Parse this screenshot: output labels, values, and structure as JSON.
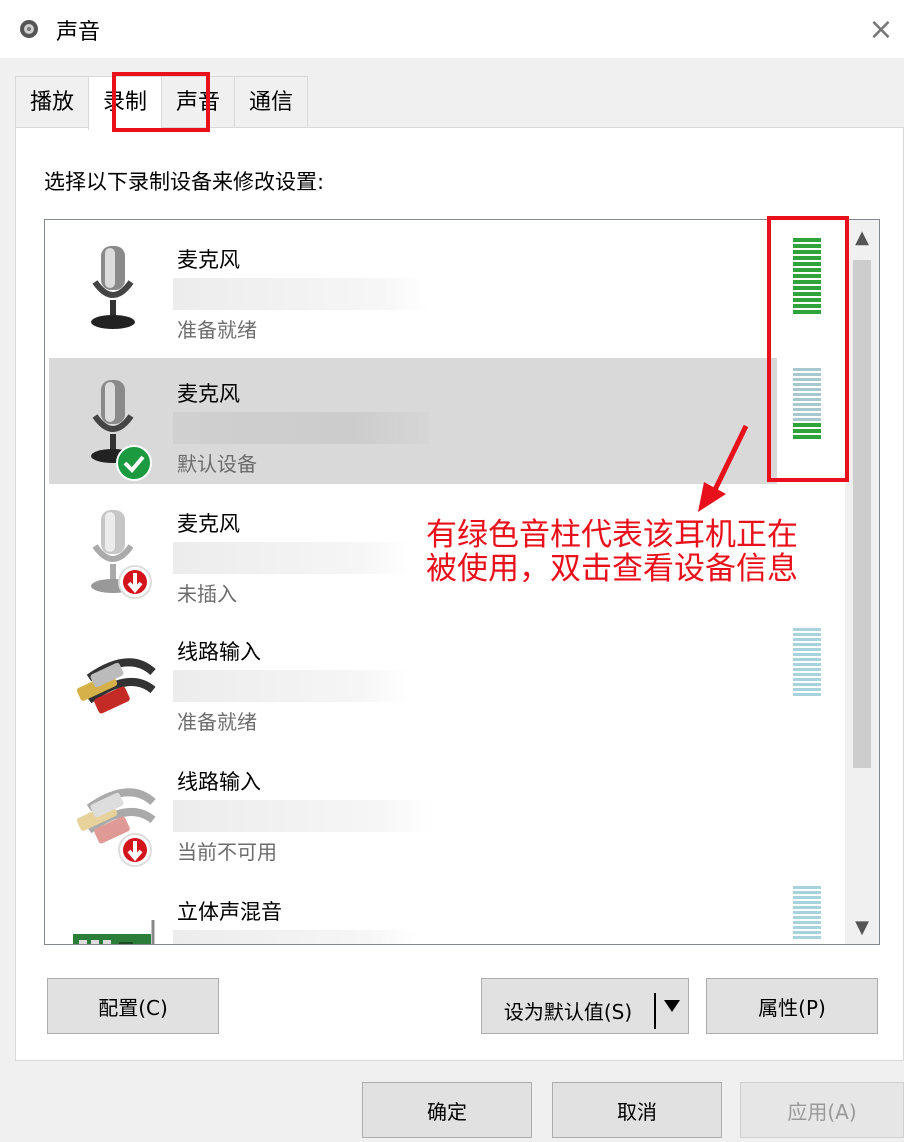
{
  "window": {
    "title": "声音",
    "close_label": "×"
  },
  "tabs": [
    {
      "label": "播放",
      "active": false
    },
    {
      "label": "录制",
      "active": true
    },
    {
      "label": "声音",
      "active": false
    },
    {
      "label": "通信",
      "active": false
    }
  ],
  "instruction": "选择以下录制设备来修改设置:",
  "devices": [
    {
      "name": "麦克风",
      "status": "准备就绪",
      "icon": "microphone-icon",
      "badge": "",
      "selected": false,
      "meter": "active"
    },
    {
      "name": "麦克风",
      "status": "默认设备",
      "icon": "microphone-icon",
      "badge": "default-check-icon",
      "selected": true,
      "meter": "partial"
    },
    {
      "name": "麦克风",
      "status": "未插入",
      "icon": "microphone-icon",
      "badge": "unplugged-icon",
      "selected": false,
      "meter": "none"
    },
    {
      "name": "线路输入",
      "status": "准备就绪",
      "icon": "line-in-cable-icon",
      "badge": "",
      "selected": false,
      "meter": "idle"
    },
    {
      "name": "线路输入",
      "status": "当前不可用",
      "icon": "line-in-cable-icon",
      "badge": "unplugged-icon",
      "selected": false,
      "meter": "none"
    },
    {
      "name": "立体声混音",
      "status": "",
      "icon": "sound-card-icon",
      "badge": "",
      "selected": false,
      "meter": "idle"
    }
  ],
  "annotation": {
    "line1": "有绿色音柱代表该耳机正在",
    "line2": "被使用，双击查看设备信息"
  },
  "buttons": {
    "configure": "配置(C)",
    "set_default": "设为默认值(S)",
    "properties": "属性(P)",
    "ok": "确定",
    "cancel": "取消",
    "apply": "应用(A)"
  },
  "colors": {
    "highlight": "#e8101a",
    "meter_active": "#2fa43a",
    "meter_idle": "#a8d2dc",
    "selected_row": "#d9d9d9"
  }
}
